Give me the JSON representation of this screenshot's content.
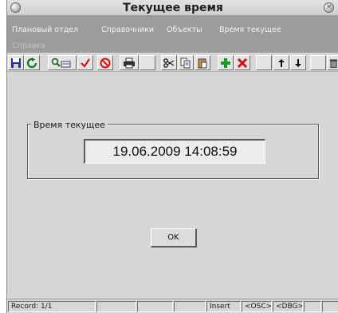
{
  "window": {
    "title": "Текущее время"
  },
  "menu": {
    "items": [
      {
        "label": "Плановый отдел",
        "enabled": true
      },
      {
        "label": "Справочники",
        "enabled": true
      },
      {
        "label": "Объекты",
        "enabled": true
      },
      {
        "label": "Время текущее",
        "enabled": true
      },
      {
        "label": "Справка",
        "enabled": false
      }
    ]
  },
  "toolbar": {
    "buttons": [
      {
        "icon": "save-icon"
      },
      {
        "icon": "refresh-icon"
      },
      {
        "icon": "query-icon"
      },
      {
        "icon": "checkmark-icon"
      },
      {
        "icon": "cancel-icon"
      },
      {
        "icon": "print-icon"
      },
      {
        "icon": "cut-icon"
      },
      {
        "icon": "copy-icon"
      },
      {
        "icon": "paste-icon"
      },
      {
        "icon": "add-record-icon"
      },
      {
        "icon": "delete-record-icon"
      },
      {
        "icon": "arrow-up-icon"
      },
      {
        "icon": "arrow-down-icon"
      },
      {
        "icon": "trash-icon"
      }
    ]
  },
  "content": {
    "group_label": "Время текущее",
    "current_time": "19.06.2009 14:08:59",
    "ok_label": "OK"
  },
  "statusbar": {
    "record": "Record: 1/1",
    "mode": "Insert",
    "osc": "<OSC>",
    "dbg": "<DBG>"
  },
  "colors": {
    "window_bg": "#d6d6d6",
    "menubar_bg": "#9c9c9c",
    "field_bg": "#ececec"
  }
}
